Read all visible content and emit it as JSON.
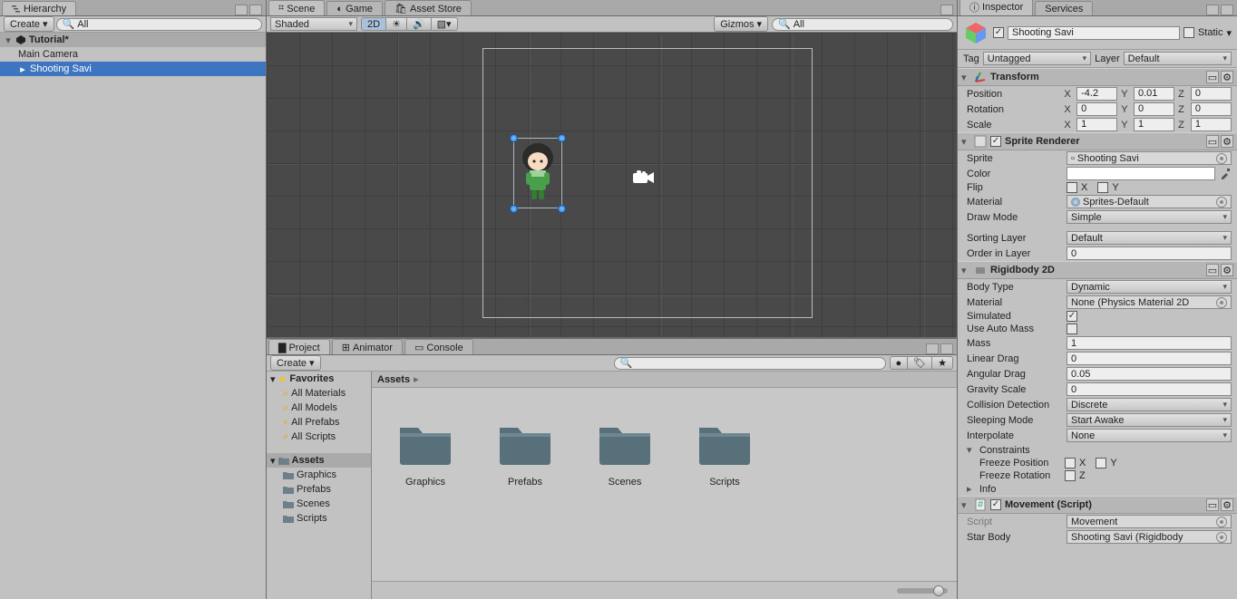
{
  "hierarchy": {
    "tab": "Hierarchy",
    "create": "Create",
    "search_prefix": "All",
    "scene": "Tutorial*",
    "items": [
      "Main Camera",
      "Shooting Savi"
    ]
  },
  "centerTabs": [
    "Scene",
    "Game",
    "Asset Store"
  ],
  "sceneToolbar": {
    "shading": "Shaded",
    "mode2d": "2D",
    "gizmos": "Gizmos",
    "search": "All"
  },
  "projectTabs": [
    "Project",
    "Animator",
    "Console"
  ],
  "project": {
    "create": "Create",
    "breadcrumb": "Assets",
    "favTitle": "Favorites",
    "favs": [
      "All Materials",
      "All Models",
      "All Prefabs",
      "All Scripts"
    ],
    "assetsTitle": "Assets",
    "tree": [
      "Graphics",
      "Prefabs",
      "Scenes",
      "Scripts"
    ],
    "folders": [
      "Graphics",
      "Prefabs",
      "Scenes",
      "Scripts"
    ]
  },
  "inspectorTabs": [
    "Inspector",
    "Services"
  ],
  "inspector": {
    "name": "Shooting Savi",
    "static": "Static",
    "tagLabel": "Tag",
    "tagValue": "Untagged",
    "layerLabel": "Layer",
    "layerValue": "Default",
    "transform": {
      "title": "Transform",
      "position": "Position",
      "pX": "-4.2",
      "pY": "0.01",
      "pZ": "0",
      "rotation": "Rotation",
      "rX": "0",
      "rY": "0",
      "rZ": "0",
      "scale": "Scale",
      "sX": "1",
      "sY": "1",
      "sZ": "1"
    },
    "spr": {
      "title": "Sprite Renderer",
      "sprite": "Sprite",
      "spriteVal": "Shooting Savi",
      "color": "Color",
      "flip": "Flip",
      "flipX": "X",
      "flipY": "Y",
      "material": "Material",
      "matVal": "Sprites-Default",
      "drawMode": "Draw Mode",
      "drawModeVal": "Simple",
      "sortLayer": "Sorting Layer",
      "sortLayerVal": "Default",
      "orderLayer": "Order in Layer",
      "orderLayerVal": "0"
    },
    "rb": {
      "title": "Rigidbody 2D",
      "bodyType": "Body Type",
      "bodyTypeVal": "Dynamic",
      "material": "Material",
      "materialVal": "None (Physics Material 2D",
      "simulated": "Simulated",
      "autoMass": "Use Auto Mass",
      "mass": "Mass",
      "massVal": "1",
      "linDrag": "Linear Drag",
      "linDragVal": "0",
      "angDrag": "Angular Drag",
      "angDragVal": "0.05",
      "grav": "Gravity Scale",
      "gravVal": "0",
      "coll": "Collision Detection",
      "collVal": "Discrete",
      "sleep": "Sleeping Mode",
      "sleepVal": "Start Awake",
      "interp": "Interpolate",
      "interpVal": "None",
      "constraints": "Constraints",
      "fp": "Freeze Position",
      "fpX": "X",
      "fpY": "Y",
      "fr": "Freeze Rotation",
      "frZ": "Z",
      "info": "Info"
    },
    "mov": {
      "title": "Movement (Script)",
      "script": "Script",
      "scriptVal": "Movement",
      "star": "Star Body",
      "starVal": "Shooting Savi (Rigidbody"
    }
  }
}
